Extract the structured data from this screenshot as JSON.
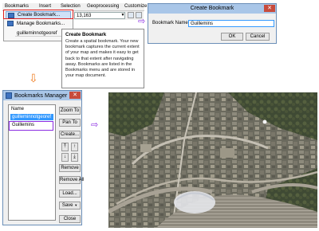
{
  "menu": {
    "items": [
      "Bookmarks",
      "Insert",
      "Selection",
      "Geoprocessing",
      "Customize"
    ],
    "dropdown": [
      "Create Bookmark...",
      "Manage Bookmarks...",
      "guilleminnotgeoref"
    ],
    "scale_value": "13,163"
  },
  "tooltip": {
    "title": "Create Bookmark",
    "body": "Create a spatial bookmark. Your new bookmark captures the current extent of your map and makes it easy to get back to that extent after navigating away. Bookmarks are listed in the Bookmarks menu and are stored in your map document."
  },
  "create_dialog": {
    "title": "Create Bookmark",
    "name_label": "Bookmark Name:",
    "name_value": "Guillemins",
    "ok": "OK",
    "cancel": "Cancel"
  },
  "manager": {
    "title": "Bookmarks Manager",
    "list_header": "Name",
    "bookmarks": [
      "guilleminnotgeoref",
      "Guillemins"
    ],
    "buttons": {
      "zoom_to": "Zoom To",
      "pan_to": "Pan To",
      "create": "Create...",
      "remove": "Remove",
      "remove_all": "Remove All",
      "load": "Load...",
      "save": "Save",
      "close": "Close"
    }
  },
  "connectors": {
    "right_arrow": "⇨",
    "down_arrow": "⇩"
  },
  "colors": {
    "highlight_red": "#e02020",
    "highlight_purple": "#8a2be2",
    "arrow_orange": "#ef7d22",
    "selection_blue": "#3399ff",
    "titlebar_blue": "#a9c6e8"
  }
}
